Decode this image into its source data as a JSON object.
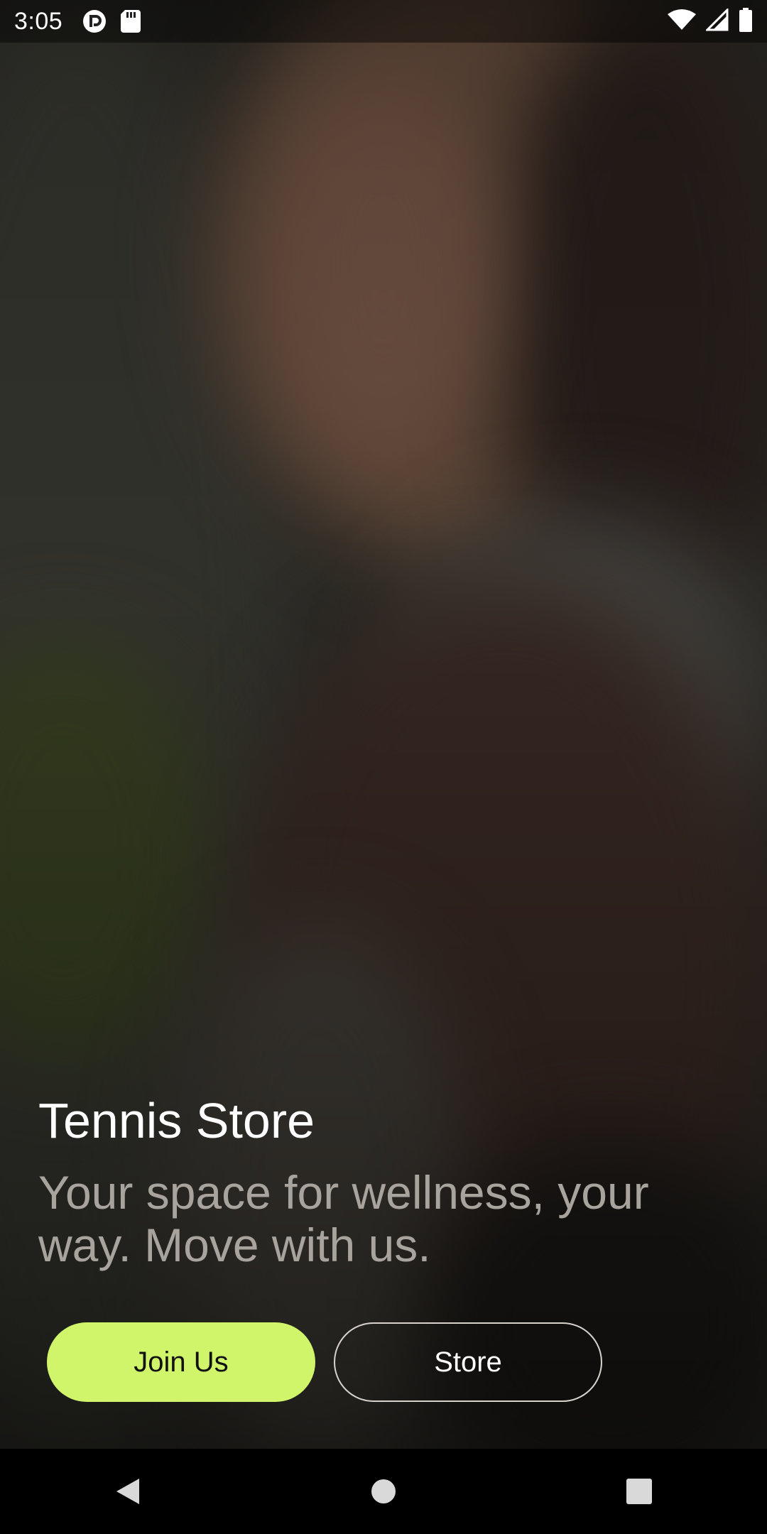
{
  "status_bar": {
    "time": "3:05",
    "left_icons": [
      "pocket-casts-icon",
      "sd-card-icon"
    ],
    "right_icons": [
      "wifi-icon",
      "signal-icon",
      "battery-icon"
    ]
  },
  "hero": {
    "title": "Tennis Store",
    "tagline": "Your space for wellness, your way. Move with us."
  },
  "buttons": {
    "primary_label": "Join Us",
    "secondary_label": "Store"
  },
  "colors": {
    "accent": "#d0f56a",
    "tagline": "#a9a39d",
    "title": "#ffffff"
  },
  "nav_bar": {
    "icons": [
      "back-icon",
      "home-icon",
      "recents-icon"
    ]
  }
}
